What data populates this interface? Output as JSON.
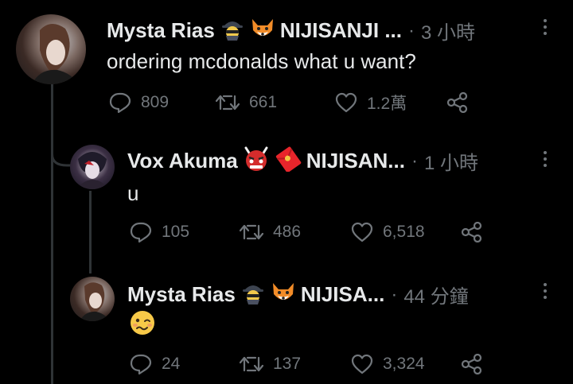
{
  "tweets": [
    {
      "name": "Mysta Rias",
      "affiliation": "NIJISANJI ...",
      "separator": "·",
      "time": "3 小時",
      "text": "ordering mcdonalds what u want?",
      "replies": "809",
      "retweets": "661",
      "likes": "1.2萬",
      "emojis": [
        "detective-emoji",
        "fox-emoji"
      ]
    },
    {
      "name": "Vox Akuma",
      "affiliation": "NIJISAN...",
      "separator": "·",
      "time": "1 小時",
      "text": "u",
      "replies": "105",
      "retweets": "486",
      "likes": "6,518",
      "emojis": [
        "ogre-emoji",
        "red-envelope-emoji"
      ]
    },
    {
      "name": "Mysta Rias",
      "affiliation": "NIJISA...",
      "separator": "·",
      "time": "44 分鐘",
      "text": "",
      "replies": "24",
      "retweets": "137",
      "likes": "3,324",
      "emojis": [
        "detective-emoji",
        "fox-emoji"
      ],
      "body_emoji": "woozy-face-emoji"
    }
  ],
  "colors": {
    "background": "#000000",
    "primary_text": "#e7e9ea",
    "secondary_text": "#71767b",
    "thread_line": "#2f3336"
  }
}
